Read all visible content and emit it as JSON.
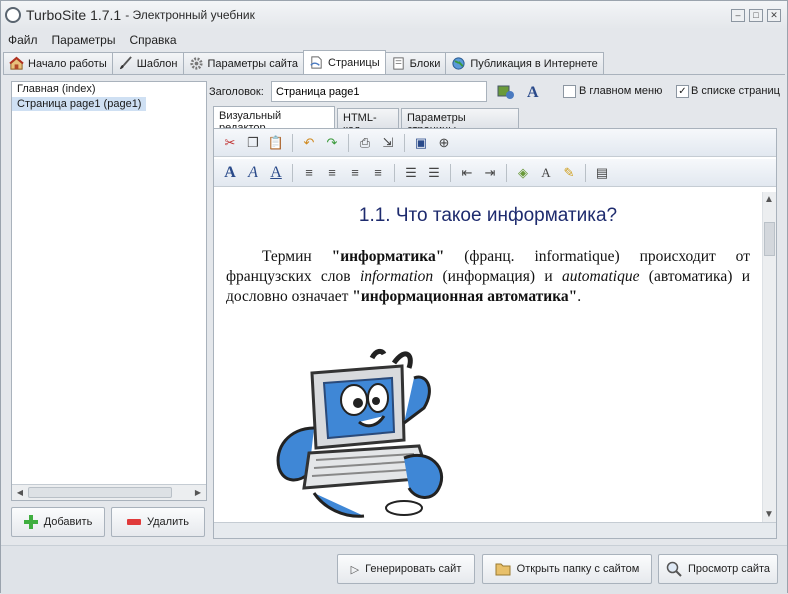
{
  "app": {
    "title": "TurboSite 1.7.1",
    "subtitle": "- Электронный учебник"
  },
  "menu": [
    "Файл",
    "Параметры",
    "Справка"
  ],
  "tabs": [
    {
      "label": "Начало работы",
      "icon": "home-icon"
    },
    {
      "label": "Шаблон",
      "icon": "brush-icon"
    },
    {
      "label": "Параметры сайта",
      "icon": "gear-icon"
    },
    {
      "label": "Страницы",
      "icon": "pages-icon"
    },
    {
      "label": "Блоки",
      "icon": "blocks-icon"
    },
    {
      "label": "Публикация в Интернете",
      "icon": "globe-icon"
    }
  ],
  "pages": [
    "Главная (index)",
    "Страница page1 (page1)"
  ],
  "left_buttons": {
    "add": "Добавить",
    "delete": "Удалить"
  },
  "header_field": {
    "label": "Заголовок:",
    "value": "Страница page1"
  },
  "checkboxes": {
    "main_menu": "В главном меню",
    "page_list": "В списке страниц"
  },
  "editor_tabs": [
    "Визуальный редактор",
    "HTML-код",
    "Параметры страницы"
  ],
  "document": {
    "heading": "1.1. Что такое информатика?",
    "p_term": "Термин ",
    "p_bold1": "\"информатика\"",
    "p_mid1": " (франц. informatique) происходит от французских слов ",
    "p_it1": "information",
    "p_mid2": " (информация) и ",
    "p_it2": "automatique",
    "p_mid3": " (автоматика) и дословно означает ",
    "p_bold2": "\"информационная автоматика\"",
    "p_end": "."
  },
  "bottom_buttons": {
    "generate": "Генерировать сайт",
    "open_folder": "Открыть папку с сайтом",
    "preview": "Просмотр сайта"
  },
  "colors": {
    "accent": "#1e2b6e",
    "selection": "#cfe0f3"
  }
}
